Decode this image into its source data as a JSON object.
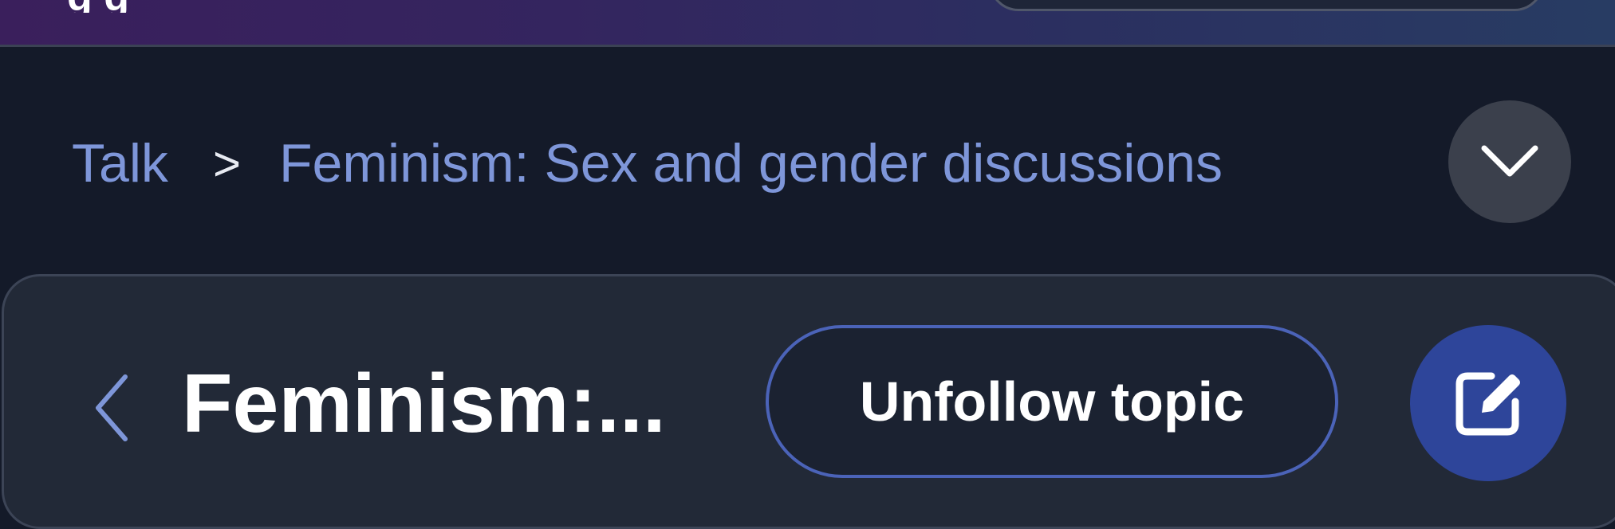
{
  "header": {
    "partial_title": "g g"
  },
  "breadcrumb": {
    "items": [
      {
        "label": "Talk"
      },
      {
        "label": "Feminism: Sex and gender discussions"
      }
    ],
    "separator": ">"
  },
  "topic": {
    "title": "Feminism:...",
    "unfollow_label": "Unfollow topic"
  },
  "icons": {
    "breadcrumb_toggle": "chevron-down-icon",
    "back": "chevron-left-icon",
    "edit": "edit-icon"
  },
  "colors": {
    "accent": "#2e459a",
    "link": "#7e96d9",
    "background": "#141a29",
    "card": "#222937"
  }
}
